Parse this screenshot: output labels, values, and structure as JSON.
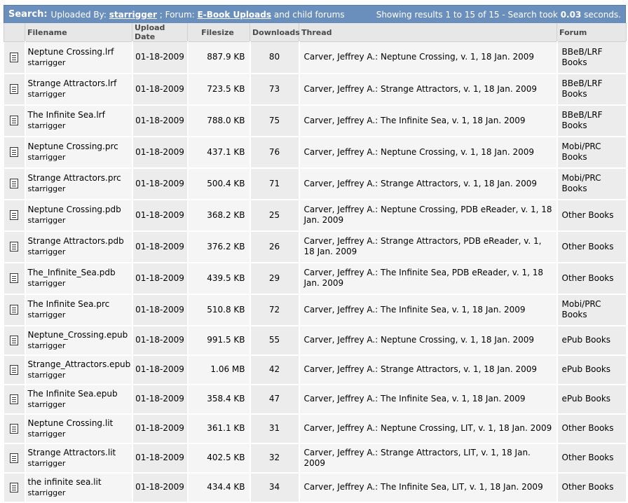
{
  "header": {
    "search_label": "Search:",
    "uploaded_by_text": "Uploaded By:",
    "uploader": "starrigger",
    "separator_forum": "; Forum:",
    "forum_link": "E-Book Uploads",
    "child_forums": "and child forums",
    "results_prefix": "Showing results 1 to 15 of 15 - Search took",
    "search_time": "0.03",
    "results_suffix": "seconds."
  },
  "columns": {
    "filename": "Filename",
    "upload_date": "Upload Date",
    "filesize": "Filesize",
    "downloads": "Downloads",
    "thread": "Thread",
    "forum": "Forum"
  },
  "rows": [
    {
      "filename": "Neptune Crossing.lrf",
      "uploader": "starrigger",
      "date": "01-18-2009",
      "size": "887.9 KB",
      "downloads": "80",
      "thread": "Carver, Jeffrey A.: Neptune Crossing, v. 1, 18 Jan. 2009",
      "forum": "BBeB/LRF Books"
    },
    {
      "filename": "Strange Attractors.lrf",
      "uploader": "starrigger",
      "date": "01-18-2009",
      "size": "723.5 KB",
      "downloads": "73",
      "thread": "Carver, Jeffrey A.: Strange Attractors, v. 1, 18 Jan. 2009",
      "forum": "BBeB/LRF Books"
    },
    {
      "filename": "The Infinite Sea.lrf",
      "uploader": "starrigger",
      "date": "01-18-2009",
      "size": "788.0 KB",
      "downloads": "75",
      "thread": "Carver, Jeffrey A.: The Infinite Sea, v. 1, 18 Jan. 2009",
      "forum": "BBeB/LRF Books"
    },
    {
      "filename": "Neptune Crossing.prc",
      "uploader": "starrigger",
      "date": "01-18-2009",
      "size": "437.1 KB",
      "downloads": "76",
      "thread": "Carver, Jeffrey A.: Neptune Crossing, v. 1, 18 Jan. 2009",
      "forum": "Mobi/PRC Books"
    },
    {
      "filename": "Strange Attractors.prc",
      "uploader": "starrigger",
      "date": "01-18-2009",
      "size": "500.4 KB",
      "downloads": "71",
      "thread": "Carver, Jeffrey A.: Strange Attractors, v. 1, 18 Jan. 2009",
      "forum": "Mobi/PRC Books"
    },
    {
      "filename": "Neptune Crossing.pdb",
      "uploader": "starrigger",
      "date": "01-18-2009",
      "size": "368.2 KB",
      "downloads": "25",
      "thread": "Carver, Jeffrey A.: Neptune Crossing, PDB eReader, v. 1, 18 Jan. 2009",
      "forum": "Other Books"
    },
    {
      "filename": "Strange Attractors.pdb",
      "uploader": "starrigger",
      "date": "01-18-2009",
      "size": "376.2 KB",
      "downloads": "26",
      "thread": "Carver, Jeffrey A.: Strange Attractors, PDB eReader, v. 1, 18 Jan. 2009",
      "forum": "Other Books"
    },
    {
      "filename": "The_Infinite_Sea.pdb",
      "uploader": "starrigger",
      "date": "01-18-2009",
      "size": "439.5 KB",
      "downloads": "29",
      "thread": "Carver, Jeffrey A.: The Infinite Sea, PDB eReader, v. 1, 18 Jan. 2009",
      "forum": "Other Books"
    },
    {
      "filename": "The Infinite Sea.prc",
      "uploader": "starrigger",
      "date": "01-18-2009",
      "size": "510.8 KB",
      "downloads": "72",
      "thread": "Carver, Jeffrey A.: The Infinite Sea, v. 1, 18 Jan. 2009",
      "forum": "Mobi/PRC Books"
    },
    {
      "filename": "Neptune_Crossing.epub",
      "uploader": "starrigger",
      "date": "01-18-2009",
      "size": "991.5 KB",
      "downloads": "55",
      "thread": "Carver, Jeffrey A.: Neptune Crossing, v. 1, 18 Jan. 2009",
      "forum": "ePub Books"
    },
    {
      "filename": "Strange_Attractors.epub",
      "uploader": "starrigger",
      "date": "01-18-2009",
      "size": "1.06 MB",
      "downloads": "42",
      "thread": "Carver, Jeffrey A.: Strange Attractors, v. 1, 18 Jan. 2009",
      "forum": "ePub Books"
    },
    {
      "filename": "The Infinite Sea.epub",
      "uploader": "starrigger",
      "date": "01-18-2009",
      "size": "358.4 KB",
      "downloads": "47",
      "thread": "Carver, Jeffrey A.: The Infinite Sea, v. 1, 18 Jan. 2009",
      "forum": "ePub Books"
    },
    {
      "filename": "Neptune Crossing.lit",
      "uploader": "starrigger",
      "date": "01-18-2009",
      "size": "361.1 KB",
      "downloads": "31",
      "thread": "Carver, Jeffrey A.: Neptune Crossing, LIT, v. 1, 18 Jan. 2009",
      "forum": "Other Books"
    },
    {
      "filename": "Strange Attractors.lit",
      "uploader": "starrigger",
      "date": "01-18-2009",
      "size": "402.5 KB",
      "downloads": "32",
      "thread": "Carver, Jeffrey A.: Strange Attractors, LIT, v. 1, 18 Jan. 2009",
      "forum": "Other Books"
    },
    {
      "filename": "the infinite sea.lit",
      "uploader": "starrigger",
      "date": "01-18-2009",
      "size": "434.4 KB",
      "downloads": "34",
      "thread": "Carver, Jeffrey A.: The Infinite Sea, LIT, v. 1, 18 Jan. 2009",
      "forum": "Other Books"
    }
  ]
}
